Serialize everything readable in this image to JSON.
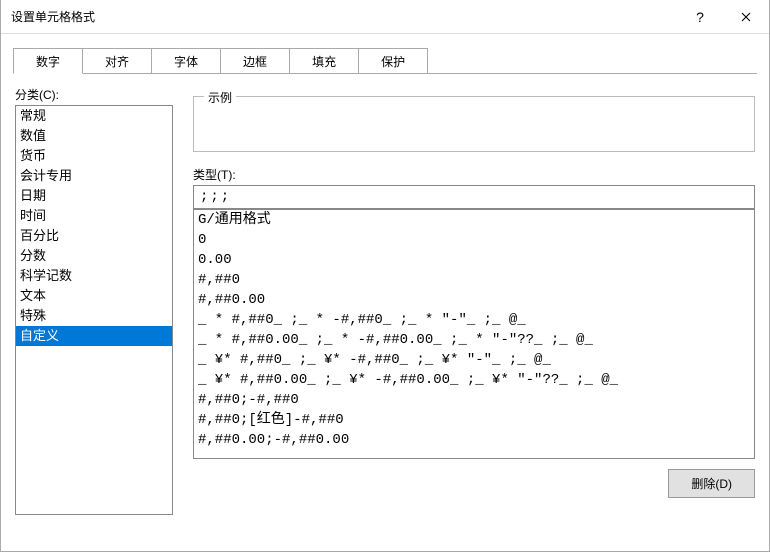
{
  "titlebar": {
    "title": "设置单元格格式"
  },
  "tabs": [
    {
      "label": "数字",
      "active": true
    },
    {
      "label": "对齐",
      "active": false
    },
    {
      "label": "字体",
      "active": false
    },
    {
      "label": "边框",
      "active": false
    },
    {
      "label": "填充",
      "active": false
    },
    {
      "label": "保护",
      "active": false
    }
  ],
  "labels": {
    "category": "分类(C):",
    "example": "示例",
    "type": "类型(T):"
  },
  "categories": [
    "常规",
    "数值",
    "货币",
    "会计专用",
    "日期",
    "时间",
    "百分比",
    "分数",
    "科学记数",
    "文本",
    "特殊",
    "自定义"
  ],
  "selected_category": "自定义",
  "type_value": ";;;",
  "formats": [
    "G/通用格式",
    "0",
    "0.00",
    "#,##0",
    "#,##0.00",
    "_ * #,##0_ ;_ * -#,##0_ ;_ * \"-\"_ ;_ @_ ",
    "_ * #,##0.00_ ;_ * -#,##0.00_ ;_ * \"-\"??_ ;_ @_ ",
    "_ ¥* #,##0_ ;_ ¥* -#,##0_ ;_ ¥* \"-\"_ ;_ @_ ",
    "_ ¥* #,##0.00_ ;_ ¥* -#,##0.00_ ;_ ¥* \"-\"??_ ;_ @_ ",
    "#,##0;-#,##0",
    "#,##0;[红色]-#,##0",
    "#,##0.00;-#,##0.00"
  ],
  "buttons": {
    "delete": "删除(D)"
  }
}
